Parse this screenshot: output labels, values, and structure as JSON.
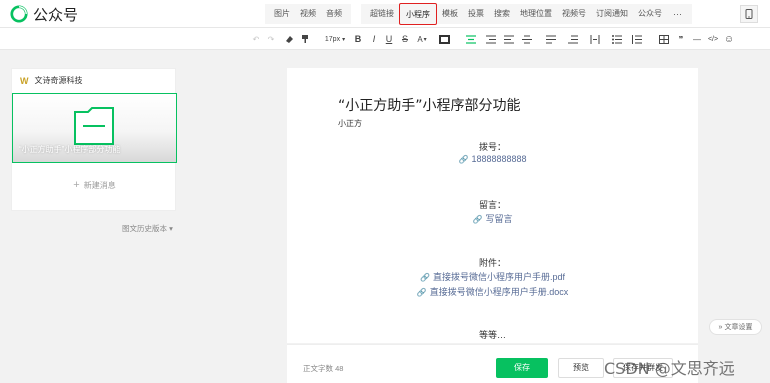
{
  "header": {
    "logo_text": "公众号",
    "brand_color": "#07c160"
  },
  "insert_toolbar": {
    "group1": [
      "图片",
      "视频",
      "音频"
    ],
    "group2": [
      "超链接",
      "小程序",
      "模板",
      "投票",
      "搜索",
      "地理位置",
      "视频号",
      "订阅通知",
      "公众号",
      "···"
    ],
    "active_item": "小程序"
  },
  "format_toolbar": {
    "undo": "↶",
    "redo": "↷",
    "font_size": "17px",
    "font_size_caret": "▾",
    "bold": "B",
    "italic": "I",
    "underline": "U",
    "strike": "S",
    "font_color": "A",
    "blockquote": "❞",
    "divider": "—",
    "code": "</>",
    "emoji": "☺"
  },
  "left_panel": {
    "account_logo": "W",
    "account_name": "文诗奇源科技",
    "article_title": "“小正方助手”小程序部分功能",
    "new_message": "新建消息",
    "new_message_plus": "+",
    "history": "图文历史版本 ▾"
  },
  "editor": {
    "title": "“小正方助手”小程序部分功能",
    "author": "小正方",
    "dial_label": "拨号：",
    "dial_value": "18888888888",
    "message_label": "留言：",
    "message_link": "写留言",
    "attachment_label": "附件：",
    "attachment_1": "直接拨号微信小程序用户手册.pdf",
    "attachment_2": "直接拨号微信小程序用户手册.docx",
    "ellipsis": "等等…",
    "link_icon": "🔗"
  },
  "bottom_bar": {
    "word_count": "正文字数 48",
    "save": "保存",
    "preview": "预览",
    "publish": "保存并群发"
  },
  "article_settings": "文章设置",
  "article_settings_icon": "»",
  "watermark": "CSDN @文思齐远"
}
